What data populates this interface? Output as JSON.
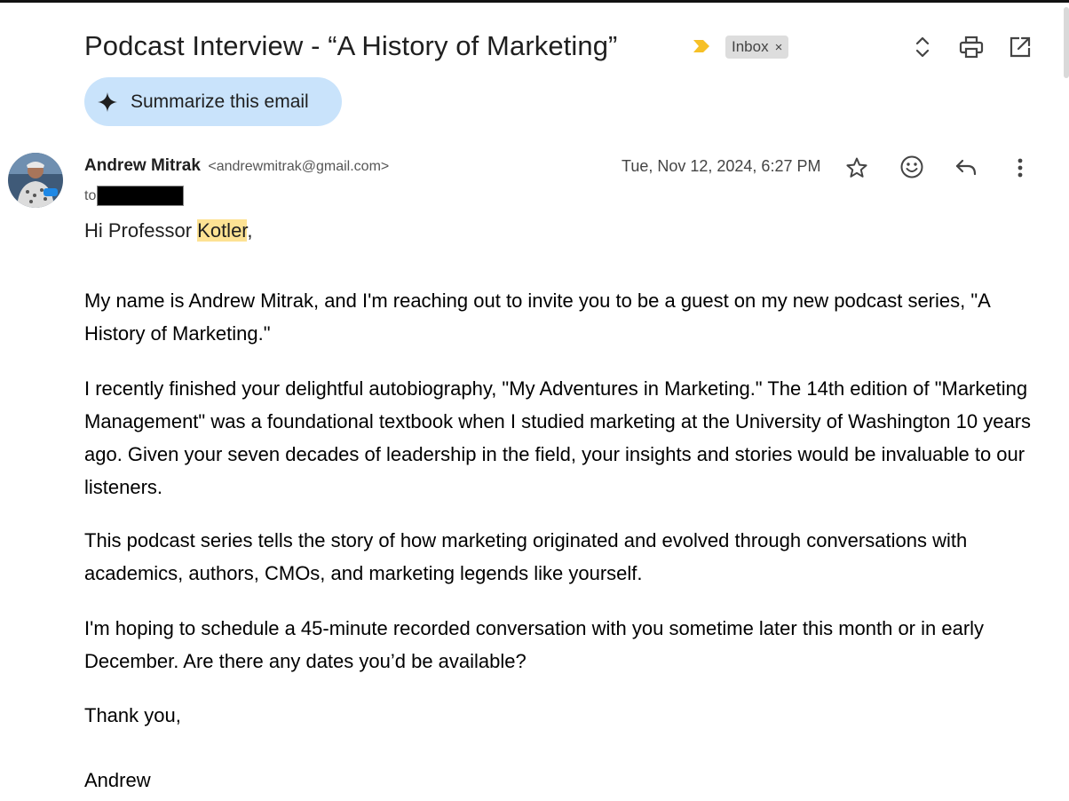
{
  "email": {
    "subject": "Podcast Interview - “A History of Marketing”",
    "label_chip": "Inbox",
    "label_chip_close": "×",
    "summarize_label": "Summarize this email",
    "sender_name": "Andrew Mitrak",
    "sender_email": "<andrewmitrak@gmail.com>",
    "to_label": "to",
    "date": "Tue, Nov 12, 2024, 6:27 PM",
    "greeting_prefix": "Hi Professor ",
    "greeting_highlight": "Kotler",
    "greeting_suffix": ",",
    "paragraphs": [
      "My name is Andrew Mitrak, and I'm reaching out to invite you to be a guest on my new podcast series, \"A History of Marketing.\"",
      "I recently finished your delightful autobiography, \"My Adventures in Marketing.\" The 14th edition of \"Marketing Management\" was a foundational textbook when I studied marketing at the University of Washington 10 years ago. Given your seven decades of leadership in the field, your insights and stories would be invaluable to our listeners.",
      "This podcast series tells the story of how marketing originated and evolved through conversations with academics, authors, CMOs, and marketing legends like yourself.",
      "I'm hoping to schedule a 45-minute recorded conversation with you sometime later this month or in early December. Are there any dates you’d be available?",
      "Thank you,",
      "Andrew"
    ]
  },
  "icons": {
    "important": "important-marker-icon",
    "expand": "expand-collapse-icon",
    "print": "print-icon",
    "open_new_window": "open-in-new-window-icon",
    "star": "star-icon",
    "emoji": "emoji-reaction-icon",
    "reply": "reply-icon",
    "more": "more-vertical-icon",
    "sparkle": "sparkle-icon"
  },
  "colors": {
    "summarize_bg": "#c9e3fb",
    "important_marker": "#f6c026",
    "highlight": "#fde293",
    "chip_bg": "#dddddd"
  }
}
